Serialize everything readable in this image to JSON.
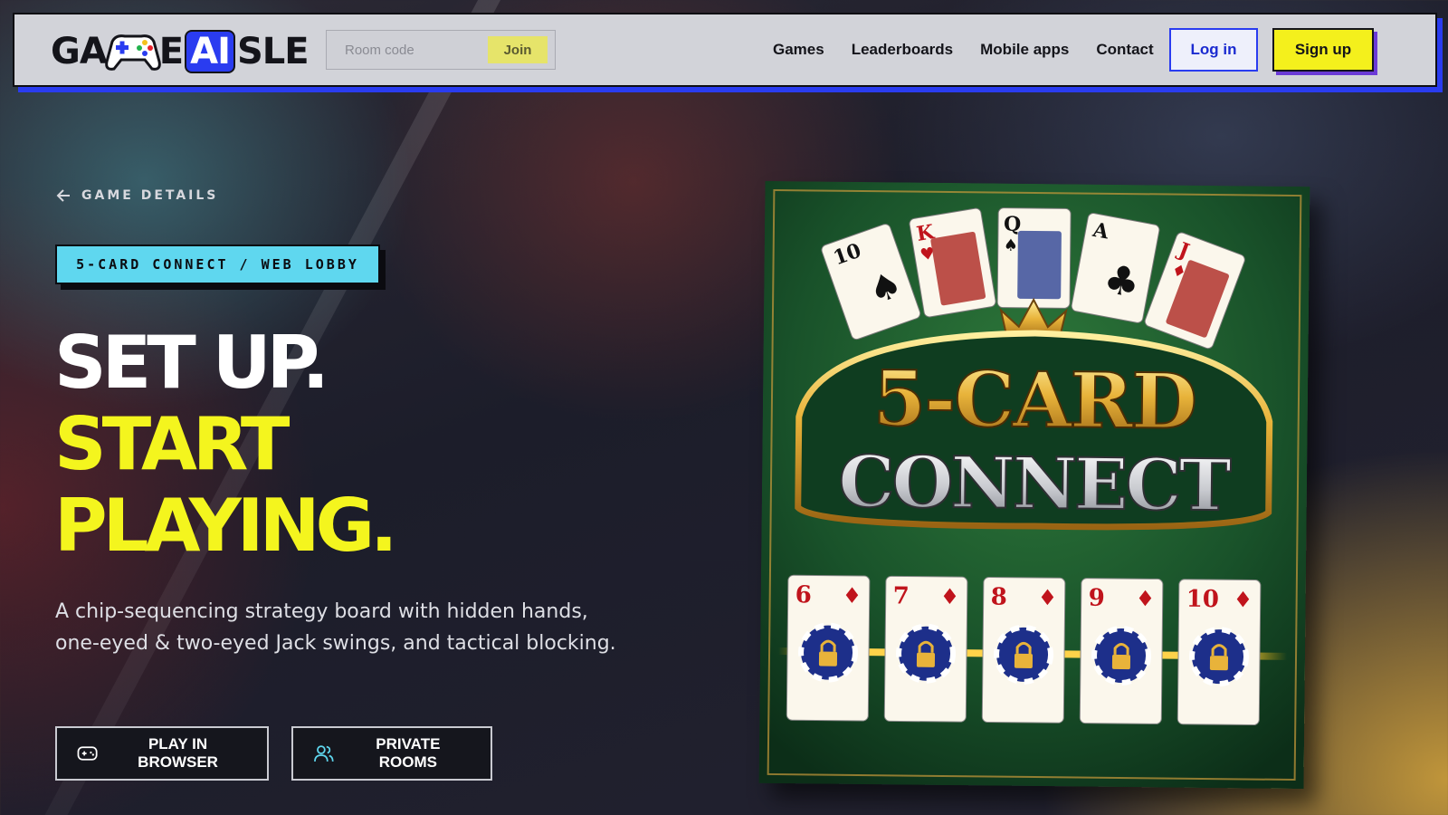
{
  "brand": {
    "logo_text_pre": "GA",
    "logo_text_e": "E",
    "logo_text_ai": "AI",
    "logo_text_post": "SLE",
    "accent_blue": "#2a3cf0",
    "accent_yellow": "#f4f01c",
    "accent_cyan": "#5fd7ef"
  },
  "header": {
    "room_placeholder": "Room code",
    "join_label": "Join",
    "nav": [
      {
        "label": "Games"
      },
      {
        "label": "Leaderboards"
      },
      {
        "label": "Mobile apps"
      },
      {
        "label": "Contact"
      }
    ],
    "login_label": "Log in",
    "signup_label": "Sign up"
  },
  "hero": {
    "back_label": "GAME DETAILS",
    "tag": "5-CARD CONNECT / WEB LOBBY",
    "title_line1": "SET UP.",
    "title_line2": "START",
    "title_line3": "PLAYING.",
    "description": "A chip-sequencing strategy board with hidden hands, one-eyed & two-eyed Jack swings, and tactical blocking.",
    "play_label": "PLAY IN BROWSER",
    "rooms_label": "PRIVATE ROOMS"
  },
  "game_art": {
    "title_line1": "5-CARD",
    "title_line2": "CONNECT",
    "top_cards": [
      {
        "rank": "10",
        "suit": "♠",
        "color": "#111111"
      },
      {
        "rank": "K",
        "suit": "♥",
        "color": "#c0141c"
      },
      {
        "rank": "Q",
        "suit": "♠",
        "color": "#111111"
      },
      {
        "rank": "A",
        "suit": "♣",
        "color": "#111111"
      },
      {
        "rank": "J",
        "suit": "♦",
        "color": "#c0141c"
      }
    ],
    "bottom_cards": [
      {
        "rank": "6",
        "suit": "♦"
      },
      {
        "rank": "7",
        "suit": "♦"
      },
      {
        "rank": "8",
        "suit": "♦"
      },
      {
        "rank": "9",
        "suit": "♦"
      },
      {
        "rank": "10",
        "suit": "♦"
      }
    ]
  }
}
